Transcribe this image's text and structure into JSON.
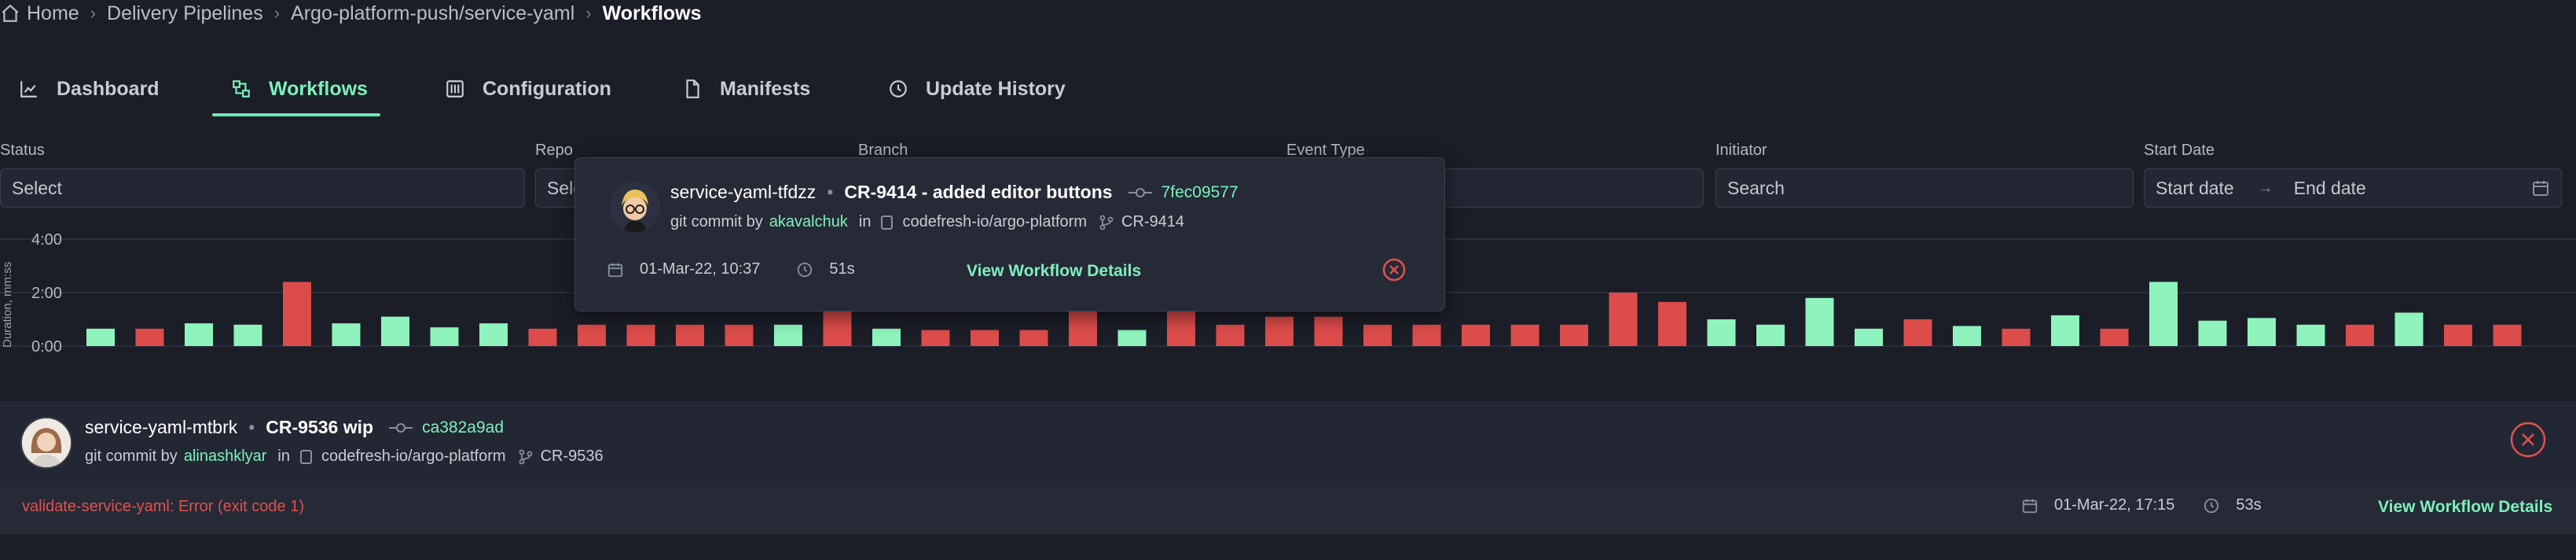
{
  "breadcrumb": {
    "items": [
      "Home",
      "Delivery Pipelines",
      "Argo-platform-push/service-yaml",
      "Workflows"
    ]
  },
  "tabs": [
    {
      "label": "Dashboard",
      "icon": "chart-icon",
      "active": false
    },
    {
      "label": "Workflows",
      "icon": "workflow-icon",
      "active": true
    },
    {
      "label": "Configuration",
      "icon": "sliders-icon",
      "active": false
    },
    {
      "label": "Manifests",
      "icon": "file-icon",
      "active": false
    },
    {
      "label": "Update History",
      "icon": "history-icon",
      "active": false
    }
  ],
  "filters": {
    "status": {
      "label": "Status",
      "placeholder": "Select"
    },
    "repo": {
      "label": "Repo",
      "placeholder": "Select"
    },
    "branch": {
      "label": "Branch",
      "placeholder": ""
    },
    "event_type": {
      "label": "Event Type",
      "placeholder": ""
    },
    "initiator": {
      "label": "Initiator",
      "placeholder": "Search"
    },
    "start_date": {
      "label": "Start Date",
      "from_placeholder": "Start date",
      "to_placeholder": "End date"
    }
  },
  "colors": {
    "accent": "#7ef0bd",
    "success_bar": "#8ef3bc",
    "fail_bar": "#dc4c4a",
    "error_text": "#e0524f",
    "background": "#1b1e27"
  },
  "chart_data": {
    "type": "bar",
    "ylabel": "Duration, mm:ss",
    "yticks": [
      "0:00",
      "2:00",
      "4:00"
    ],
    "ylim": [
      0,
      4
    ],
    "grid": true,
    "values": [
      0.65,
      0.65,
      0.85,
      0.8,
      2.4,
      0.85,
      1.1,
      0.7,
      0.85,
      0.65,
      0.8,
      0.8,
      0.8,
      0.8,
      0.8,
      1.3,
      0.65,
      0.6,
      0.6,
      0.6,
      1.3,
      0.6,
      1.3,
      0.8,
      1.1,
      1.1,
      0.8,
      0.8,
      0.8,
      0.8,
      0.8,
      2.0,
      1.65,
      1.0,
      0.8,
      1.8,
      0.65,
      1.0,
      0.75,
      0.65,
      1.15,
      0.65,
      2.4,
      0.95,
      1.05,
      0.8,
      0.8,
      1.25,
      0.8,
      0.8
    ],
    "status": [
      "s",
      "f",
      "s",
      "s",
      "f",
      "s",
      "s",
      "s",
      "s",
      "f",
      "f",
      "f",
      "f",
      "f",
      "s",
      "f",
      "s",
      "f",
      "f",
      "f",
      "f",
      "s",
      "f",
      "f",
      "f",
      "f",
      "f",
      "f",
      "f",
      "f",
      "f",
      "f",
      "f",
      "s",
      "s",
      "s",
      "s",
      "f",
      "s",
      "f",
      "s",
      "f",
      "s",
      "s",
      "s",
      "s",
      "f",
      "s",
      "f",
      "f"
    ]
  },
  "popup": {
    "name": "service-yaml-tfdzz",
    "separator": "•",
    "message": "CR-9414 - added editor buttons",
    "sha": "7fec09577",
    "event_prefix": "git commit by",
    "user": "akavalchuk",
    "in_label": "in",
    "repo": "codefresh-io/argo-platform",
    "branch": "CR-9414",
    "date": "01-Mar-22, 10:37",
    "duration": "51s",
    "link": "View Workflow Details",
    "status": "failed"
  },
  "workflow": {
    "name": "service-yaml-mtbrk",
    "separator": "•",
    "message": "CR-9536 wip",
    "sha": "ca382a9ad",
    "event_prefix": "git commit by",
    "user": "alinashklyar",
    "in_label": "in",
    "repo": "codefresh-io/argo-platform",
    "branch": "CR-9536",
    "error": "validate-service-yaml: Error (exit code 1)",
    "date": "01-Mar-22, 17:15",
    "duration": "53s",
    "link": "View Workflow Details",
    "status": "failed"
  }
}
